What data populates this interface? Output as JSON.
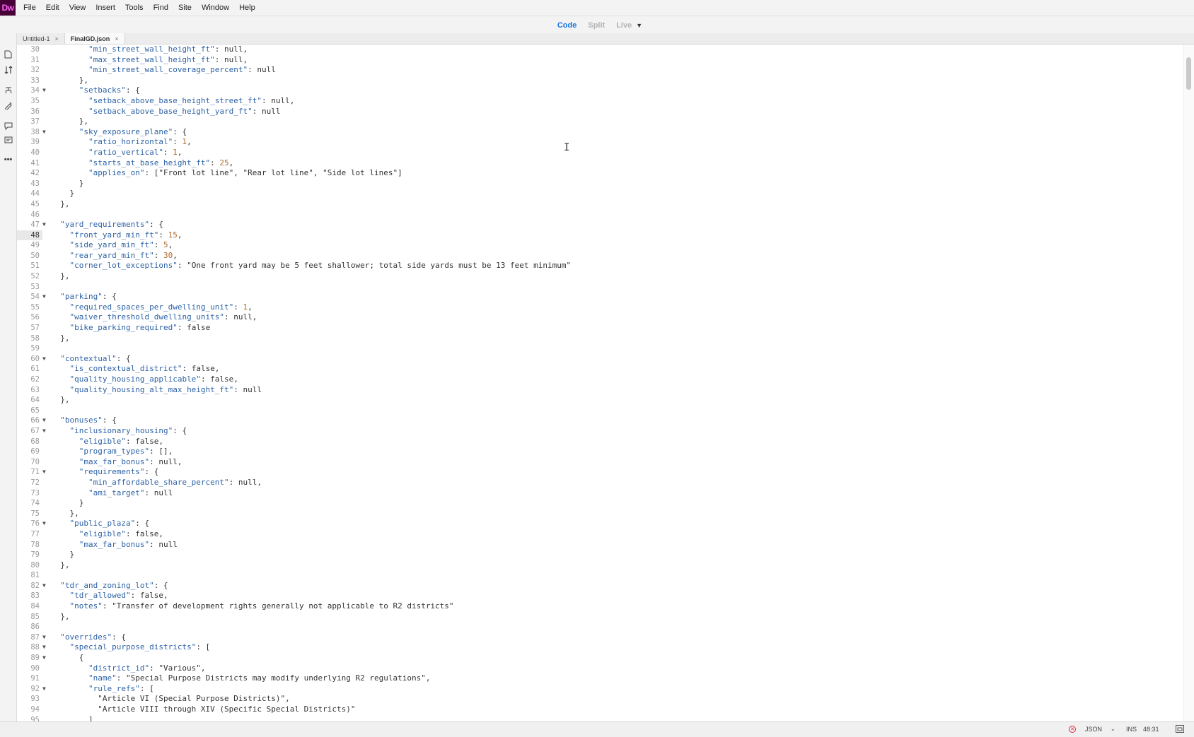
{
  "app": {
    "logo": "Dw",
    "menu": [
      "File",
      "Edit",
      "View",
      "Insert",
      "Tools",
      "Find",
      "Site",
      "Window",
      "Help"
    ]
  },
  "view_switcher": {
    "items": [
      "Code",
      "Split",
      "Live"
    ],
    "active": "Code"
  },
  "tabs": [
    {
      "label": "Untitled-1",
      "active": false
    },
    {
      "label": "FinalGD.json",
      "active": true
    }
  ],
  "left_tools": [
    "file-icon",
    "transfer-icon",
    "hint-icon",
    "format-icon",
    "comment-icon",
    "snippet-icon",
    "more-icon"
  ],
  "editor": {
    "current_line": 48,
    "lines": [
      {
        "n": "30",
        "fold": false,
        "text": "        \"min_street_wall_height_ft\": null,"
      },
      {
        "n": "31",
        "fold": false,
        "text": "        \"max_street_wall_height_ft\": null,"
      },
      {
        "n": "32",
        "fold": false,
        "text": "        \"min_street_wall_coverage_percent\": null"
      },
      {
        "n": "33",
        "fold": false,
        "text": "      },"
      },
      {
        "n": "34",
        "fold": true,
        "text": "      \"setbacks\": {"
      },
      {
        "n": "35",
        "fold": false,
        "text": "        \"setback_above_base_height_street_ft\": null,"
      },
      {
        "n": "36",
        "fold": false,
        "text": "        \"setback_above_base_height_yard_ft\": null"
      },
      {
        "n": "37",
        "fold": false,
        "text": "      },"
      },
      {
        "n": "38",
        "fold": true,
        "text": "      \"sky_exposure_plane\": {"
      },
      {
        "n": "39",
        "fold": false,
        "text": "        \"ratio_horizontal\": 1,"
      },
      {
        "n": "40",
        "fold": false,
        "text": "        \"ratio_vertical\": 1,"
      },
      {
        "n": "41",
        "fold": false,
        "text": "        \"starts_at_base_height_ft\": 25,"
      },
      {
        "n": "42",
        "fold": false,
        "text": "        \"applies_on\": [\"Front lot line\", \"Rear lot line\", \"Side lot lines\"]"
      },
      {
        "n": "43",
        "fold": false,
        "text": "      }"
      },
      {
        "n": "44",
        "fold": false,
        "text": "    }"
      },
      {
        "n": "45",
        "fold": false,
        "text": "  },"
      },
      {
        "n": "46",
        "fold": false,
        "text": ""
      },
      {
        "n": "47",
        "fold": true,
        "text": "  \"yard_requirements\": {"
      },
      {
        "n": "48",
        "fold": false,
        "text": "    \"front_yard_min_ft\": 15,"
      },
      {
        "n": "49",
        "fold": false,
        "text": "    \"side_yard_min_ft\": 5,"
      },
      {
        "n": "50",
        "fold": false,
        "text": "    \"rear_yard_min_ft\": 30,"
      },
      {
        "n": "51",
        "fold": false,
        "text": "    \"corner_lot_exceptions\": \"One front yard may be 5 feet shallower; total side yards must be 13 feet minimum\""
      },
      {
        "n": "52",
        "fold": false,
        "text": "  },"
      },
      {
        "n": "53",
        "fold": false,
        "text": ""
      },
      {
        "n": "54",
        "fold": true,
        "text": "  \"parking\": {"
      },
      {
        "n": "55",
        "fold": false,
        "text": "    \"required_spaces_per_dwelling_unit\": 1,"
      },
      {
        "n": "56",
        "fold": false,
        "text": "    \"waiver_threshold_dwelling_units\": null,"
      },
      {
        "n": "57",
        "fold": false,
        "text": "    \"bike_parking_required\": false"
      },
      {
        "n": "58",
        "fold": false,
        "text": "  },"
      },
      {
        "n": "59",
        "fold": false,
        "text": ""
      },
      {
        "n": "60",
        "fold": true,
        "text": "  \"contextual\": {"
      },
      {
        "n": "61",
        "fold": false,
        "text": "    \"is_contextual_district\": false,"
      },
      {
        "n": "62",
        "fold": false,
        "text": "    \"quality_housing_applicable\": false,"
      },
      {
        "n": "63",
        "fold": false,
        "text": "    \"quality_housing_alt_max_height_ft\": null"
      },
      {
        "n": "64",
        "fold": false,
        "text": "  },"
      },
      {
        "n": "65",
        "fold": false,
        "text": ""
      },
      {
        "n": "66",
        "fold": true,
        "text": "  \"bonuses\": {"
      },
      {
        "n": "67",
        "fold": true,
        "text": "    \"inclusionary_housing\": {"
      },
      {
        "n": "68",
        "fold": false,
        "text": "      \"eligible\": false,"
      },
      {
        "n": "69",
        "fold": false,
        "text": "      \"program_types\": [],"
      },
      {
        "n": "70",
        "fold": false,
        "text": "      \"max_far_bonus\": null,"
      },
      {
        "n": "71",
        "fold": true,
        "text": "      \"requirements\": {"
      },
      {
        "n": "72",
        "fold": false,
        "text": "        \"min_affordable_share_percent\": null,"
      },
      {
        "n": "73",
        "fold": false,
        "text": "        \"ami_target\": null"
      },
      {
        "n": "74",
        "fold": false,
        "text": "      }"
      },
      {
        "n": "75",
        "fold": false,
        "text": "    },"
      },
      {
        "n": "76",
        "fold": true,
        "text": "    \"public_plaza\": {"
      },
      {
        "n": "77",
        "fold": false,
        "text": "      \"eligible\": false,"
      },
      {
        "n": "78",
        "fold": false,
        "text": "      \"max_far_bonus\": null"
      },
      {
        "n": "79",
        "fold": false,
        "text": "    }"
      },
      {
        "n": "80",
        "fold": false,
        "text": "  },"
      },
      {
        "n": "81",
        "fold": false,
        "text": ""
      },
      {
        "n": "82",
        "fold": true,
        "text": "  \"tdr_and_zoning_lot\": {"
      },
      {
        "n": "83",
        "fold": false,
        "text": "    \"tdr_allowed\": false,"
      },
      {
        "n": "84",
        "fold": false,
        "text": "    \"notes\": \"Transfer of development rights generally not applicable to R2 districts\""
      },
      {
        "n": "85",
        "fold": false,
        "text": "  },"
      },
      {
        "n": "86",
        "fold": false,
        "text": ""
      },
      {
        "n": "87",
        "fold": true,
        "text": "  \"overrides\": {"
      },
      {
        "n": "88",
        "fold": true,
        "text": "    \"special_purpose_districts\": ["
      },
      {
        "n": "89",
        "fold": true,
        "text": "      {"
      },
      {
        "n": "90",
        "fold": false,
        "text": "        \"district_id\": \"Various\","
      },
      {
        "n": "91",
        "fold": false,
        "text": "        \"name\": \"Special Purpose Districts may modify underlying R2 regulations\","
      },
      {
        "n": "92",
        "fold": true,
        "text": "        \"rule_refs\": ["
      },
      {
        "n": "93",
        "fold": false,
        "text": "          \"Article VI (Special Purpose Districts)\","
      },
      {
        "n": "94",
        "fold": false,
        "text": "          \"Article VIII through XIV (Specific Special Districts)\""
      },
      {
        "n": "95",
        "fold": false,
        "text": "        ]"
      }
    ]
  },
  "status": {
    "language": "JSON",
    "mode": "INS",
    "position": "48:31"
  },
  "colors": {
    "key": "#2e63a6",
    "number": "#b06a2a",
    "accent": "#1473e6",
    "error": "#e0243a"
  }
}
